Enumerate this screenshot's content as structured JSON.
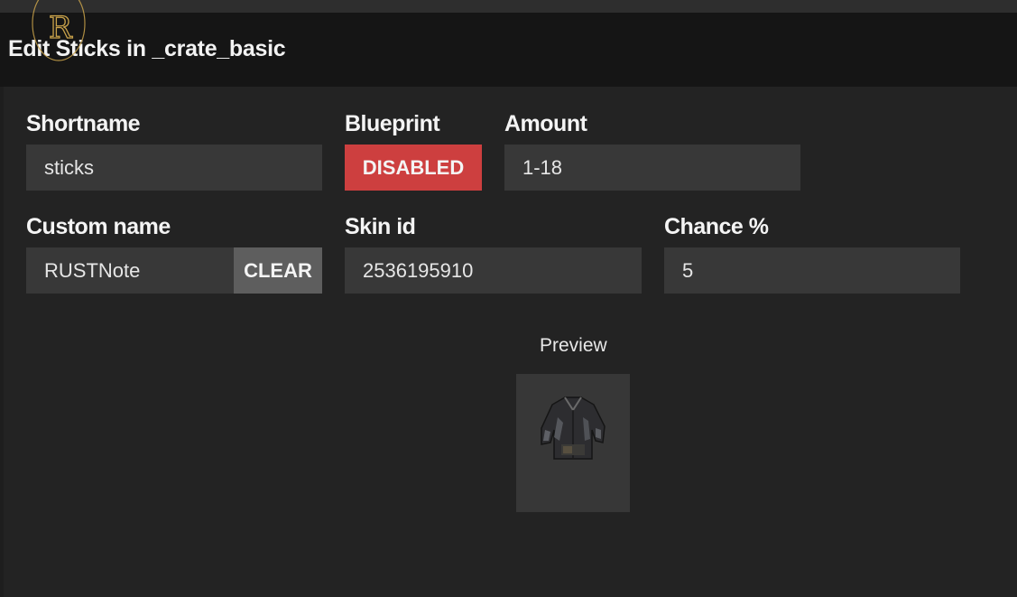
{
  "window": {
    "title": "Edit Sticks in _crate_basic"
  },
  "logo": {
    "letter": "R",
    "name": "rustnote-logo"
  },
  "form": {
    "shortname": {
      "label": "Shortname",
      "value": "sticks"
    },
    "blueprint": {
      "label": "Blueprint",
      "button": "DISABLED"
    },
    "amount": {
      "label": "Amount",
      "value": "1-18"
    },
    "custom_name": {
      "label": "Custom name",
      "value": "RUSTNote",
      "clear": "CLEAR"
    },
    "skin_id": {
      "label": "Skin id",
      "value": "2536195910"
    },
    "chance": {
      "label": "Chance %",
      "value": "5"
    }
  },
  "preview": {
    "label": "Preview",
    "icon": "jacket-icon"
  },
  "colors": {
    "disabled": "#cd3f3f",
    "field_bg": "#383838",
    "panel_bg": "#232323",
    "header_bg": "#151515",
    "logo_gold": "#c9a24a"
  }
}
